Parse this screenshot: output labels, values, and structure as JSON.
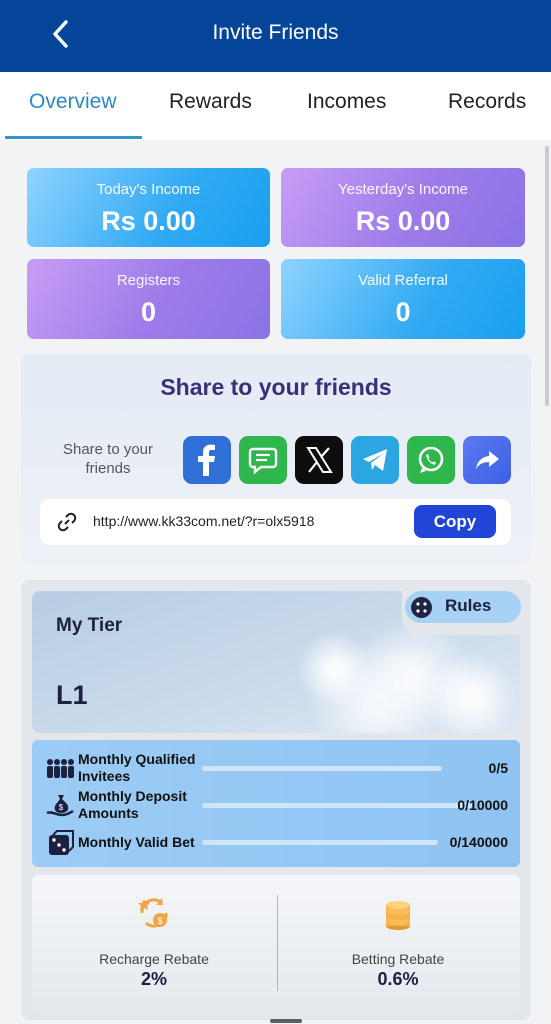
{
  "header": {
    "title": "Invite Friends"
  },
  "tabs": [
    "Overview",
    "Rewards",
    "Incomes",
    "Records"
  ],
  "stats": {
    "today": {
      "label": "Today's Income",
      "value": "Rs 0.00"
    },
    "yesterday": {
      "label": "Yesterday's Income",
      "value": "Rs 0.00"
    },
    "registers": {
      "label": "Registers",
      "value": "0"
    },
    "valid_referral": {
      "label": "Valid Referral",
      "value": "0"
    }
  },
  "share": {
    "title": "Share to your friends",
    "label": "Share to your friends",
    "link": "http://www.kk33com.net/?r=olx5918",
    "copy_label": "Copy",
    "icons": [
      "facebook-icon",
      "sms-icon",
      "x-icon",
      "telegram-icon",
      "whatsapp-icon",
      "share-forward-icon"
    ]
  },
  "tier": {
    "title": "My Tier",
    "level": "L1",
    "rules_label": "Rules",
    "progress": [
      {
        "label": "Monthly Qualified Invitees",
        "value": "0/5",
        "fraction": 0
      },
      {
        "label": "Monthly Deposit Amounts",
        "value": "0/10000",
        "fraction": 0
      },
      {
        "label": "Monthly Valid Bet",
        "value": "0/140000",
        "fraction": 0
      }
    ]
  },
  "rebates": {
    "recharge": {
      "label": "Recharge Rebate",
      "value": "2%"
    },
    "betting": {
      "label": "Betting Rebate",
      "value": "0.6%"
    }
  },
  "colors": {
    "header": "#04459a",
    "tab_active": "#2a88c4",
    "share_title": "#3b2f7a",
    "copy_button": "#2145d6"
  }
}
